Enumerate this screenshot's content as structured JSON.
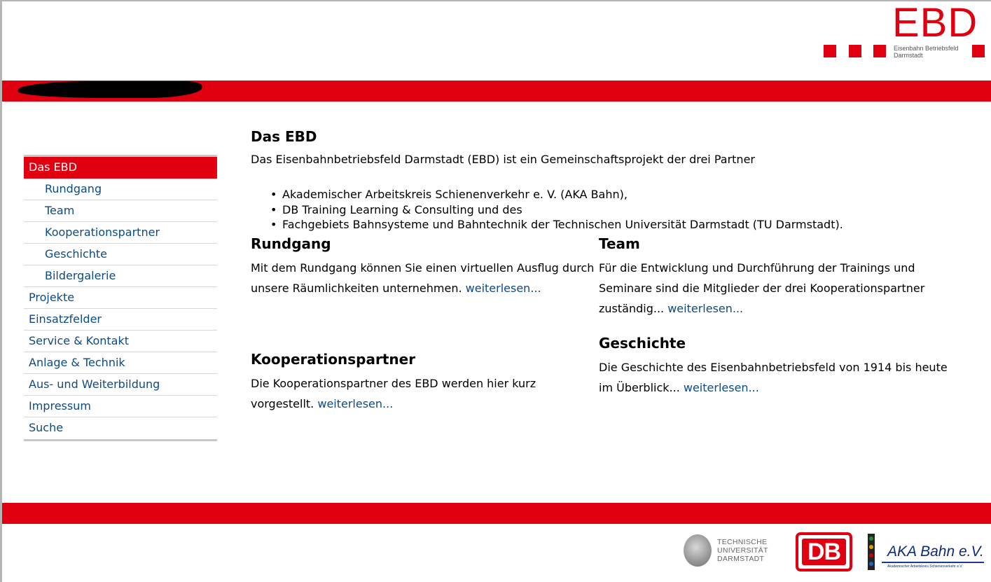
{
  "logo": {
    "letters": "EBD",
    "subtitle_line1": "Eisenbahn Betriebsfeld",
    "subtitle_line2": "Darmstadt"
  },
  "nav": {
    "items": [
      {
        "label": "Das EBD",
        "level": 0,
        "active": true
      },
      {
        "label": "Rundgang",
        "level": 1
      },
      {
        "label": "Team",
        "level": 1
      },
      {
        "label": "Kooperationspartner",
        "level": 1
      },
      {
        "label": "Geschichte",
        "level": 1
      },
      {
        "label": "Bildergalerie",
        "level": 1
      },
      {
        "label": "Projekte",
        "level": 0
      },
      {
        "label": "Einsatzfelder",
        "level": 0
      },
      {
        "label": "Service & Kontakt",
        "level": 0
      },
      {
        "label": "Anlage & Technik",
        "level": 0
      },
      {
        "label": "Aus- und Weiterbildung",
        "level": 0
      },
      {
        "label": "Impressum",
        "level": 0
      },
      {
        "label": "Suche",
        "level": 0
      }
    ]
  },
  "main": {
    "title": "Das EBD",
    "intro": "Das Eisenbahnbetriebsfeld Darmstadt (EBD) ist ein Gemeinschaftsprojekt der drei Partner",
    "partners": [
      "Akademischer Arbeitskreis Schienenverkehr e. V. (AKA Bahn),",
      "DB Training Learning & Consulting und des",
      "Fachgebiets Bahnsysteme und Bahntechnik der Technischen Universität Darmstadt (TU Darmstadt)."
    ],
    "sections": {
      "rundgang": {
        "title": "Rundgang",
        "text": "Mit dem Rundgang können Sie einen virtuellen Ausflug durch unsere Räumlichkeiten unternehmen.",
        "link": "weiterlesen..."
      },
      "team": {
        "title": "Team",
        "text": "Für die Entwicklung und Durchführung der Trainings und Seminare sind die Mitglieder der drei Kooperationspartner zuständig...",
        "link": "weiterlesen..."
      },
      "kooperationspartner": {
        "title": "Kooperationspartner",
        "text": "Die Kooperationspartner des EBD werden hier kurz vorgestellt.",
        "link": "weiterlesen..."
      },
      "geschichte": {
        "title": "Geschichte",
        "text": "Die Geschichte des Eisenbahnbetriebsfeld von 1914 bis heute im Überblick...",
        "link": "weiterlesen..."
      }
    }
  },
  "footer": {
    "tu_line1": "TECHNISCHE",
    "tu_line2": "UNIVERSITÄT",
    "tu_line3": "DARMSTADT",
    "db_label": "DB",
    "aka_label": "AKA Bahn e.V.",
    "aka_sub": "Akademischer Arbeitskreis Schienenverkehr e.V."
  },
  "colors": {
    "brand_red": "#e1000f",
    "link_blue": "#0e4a84"
  }
}
